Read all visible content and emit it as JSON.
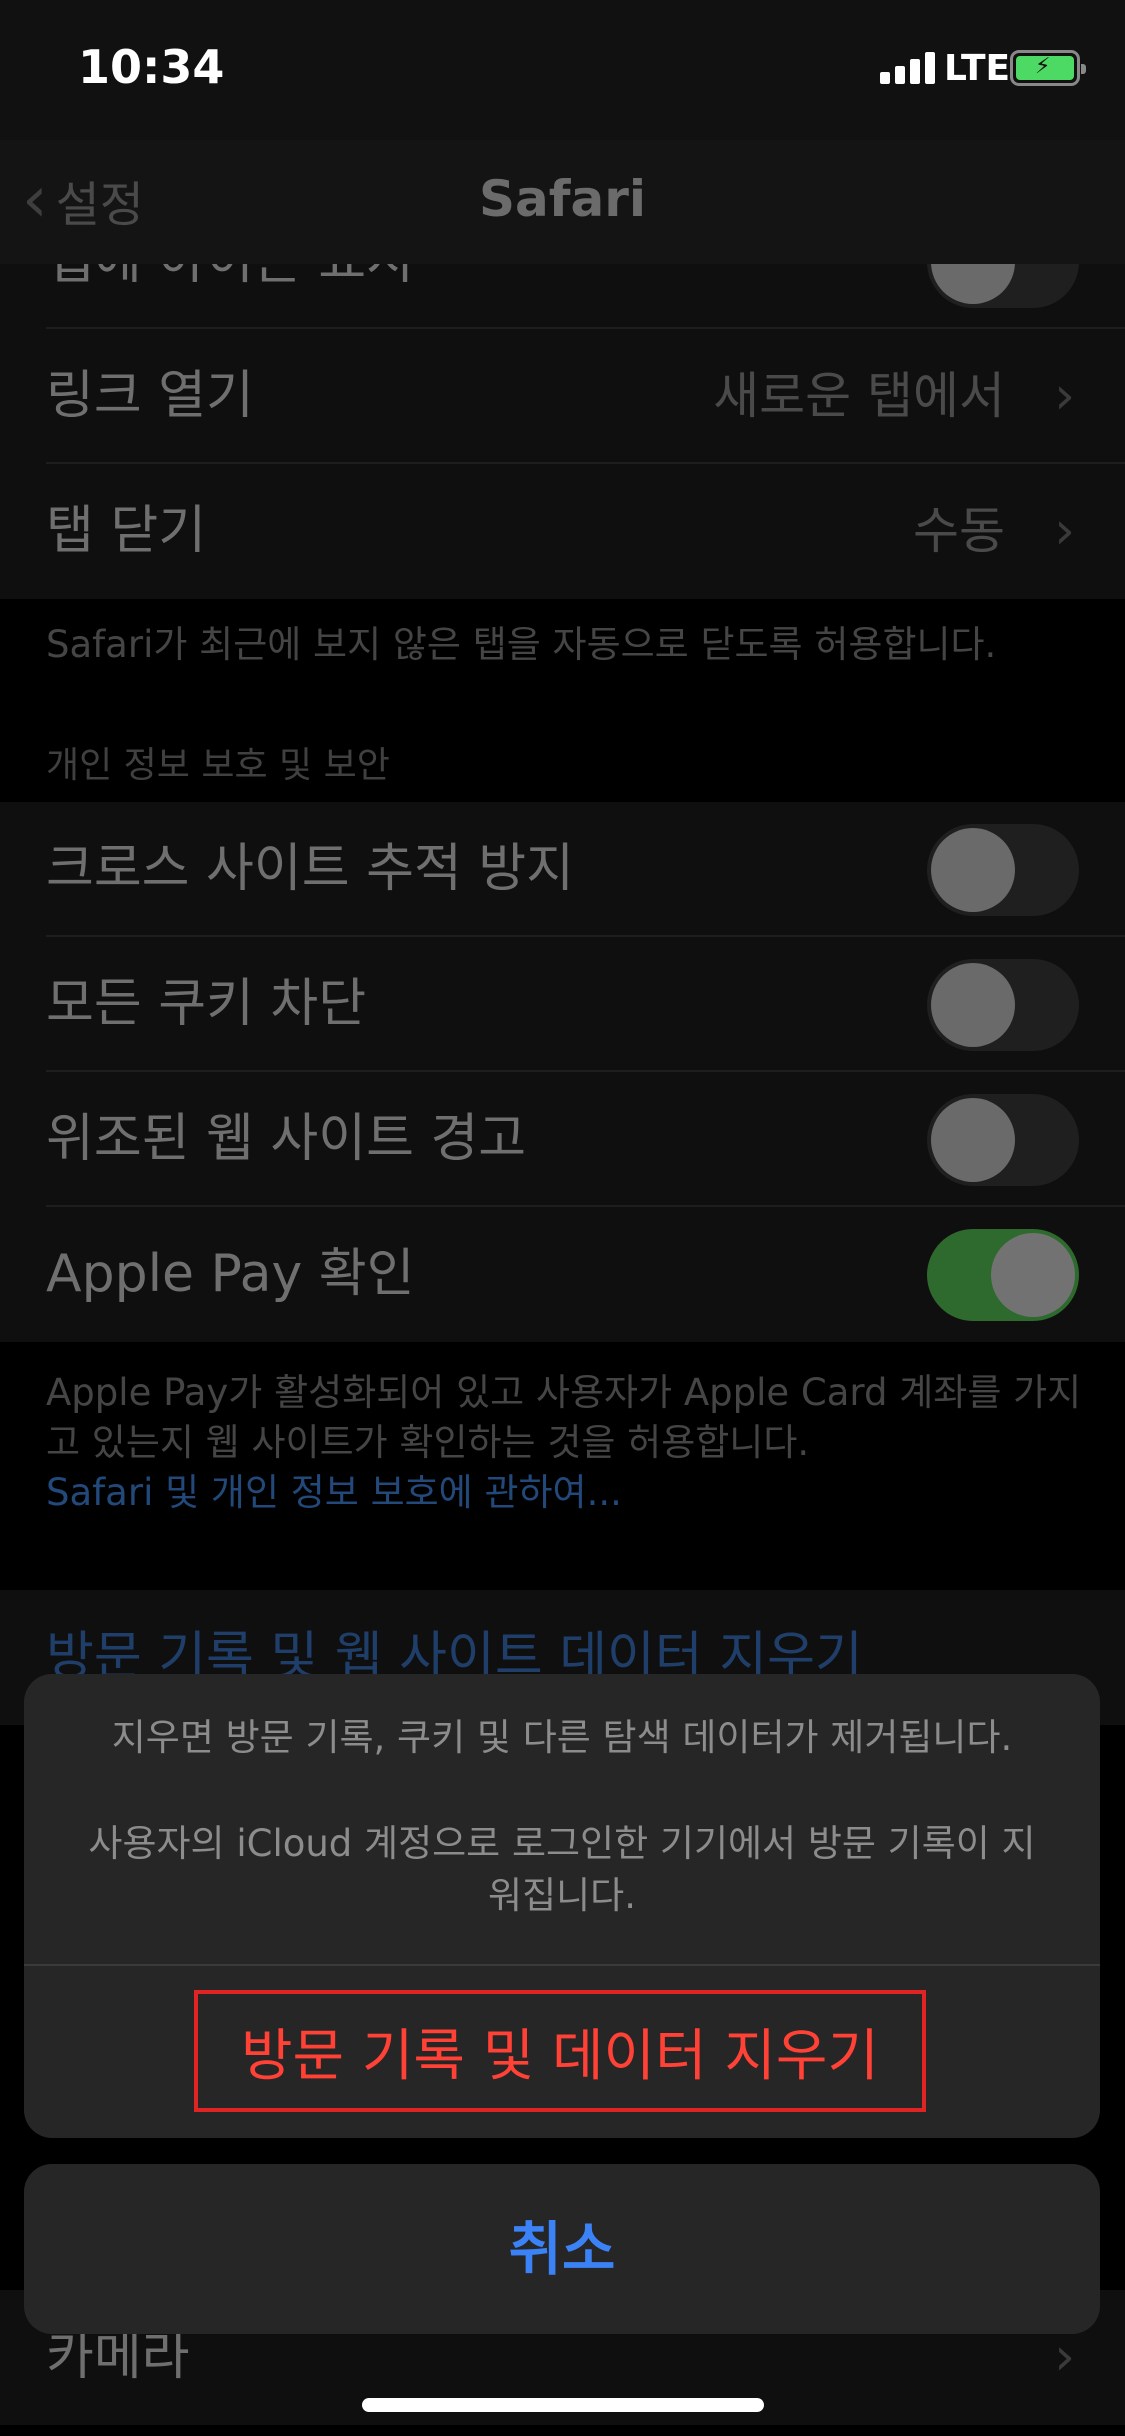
{
  "status_bar": {
    "time": "10:34",
    "network": "LTE"
  },
  "nav": {
    "back_label": "설정",
    "title": "Safari"
  },
  "tabs_group": {
    "partial_label": "탭에 아이콘 표시",
    "rows": [
      {
        "label": "링크 열기",
        "value": "새로운 탭에서"
      },
      {
        "label": "탭 닫기",
        "value": "수동"
      }
    ],
    "footnote": "Safari가 최근에 보지 않은 탭을 자동으로 닫도록 허용합니다."
  },
  "privacy": {
    "header": "개인 정보 보호 및 보안",
    "rows": [
      {
        "label": "크로스 사이트 추적 방지",
        "on": false
      },
      {
        "label": "모든 쿠키 차단",
        "on": false
      },
      {
        "label": "위조된 웹 사이트 경고",
        "on": false
      },
      {
        "label": "Apple Pay 확인",
        "on": true
      }
    ],
    "footnote": "Apple Pay가 활성화되어 있고 사용자가 Apple Card 계좌를 가지고 있는지 웹 사이트가 확인하는 것을 허용합니다.",
    "footnote_link": "Safari 및 개인 정보 보호에 관하여..."
  },
  "clear_history_row": {
    "label": "방문 기록 및 웹 사이트 데이터 지우기"
  },
  "camera_row": {
    "label": "카메라"
  },
  "action_sheet": {
    "message_line1": "지우면 방문 기록, 쿠키 및 다른 탐색 데이터가 제거됩니다.",
    "message_line2": "사용자의 iCloud 계정으로 로그인한 기기에서 방문 기록이 지워집니다.",
    "destructive_label": "방문 기록 및 데이터 지우기",
    "cancel_label": "취소"
  },
  "colors": {
    "toggle_on": "#2e6a2e",
    "destructive": "#ff4136",
    "highlight_border": "#e02424",
    "accent_blue": "#3b82f6"
  }
}
